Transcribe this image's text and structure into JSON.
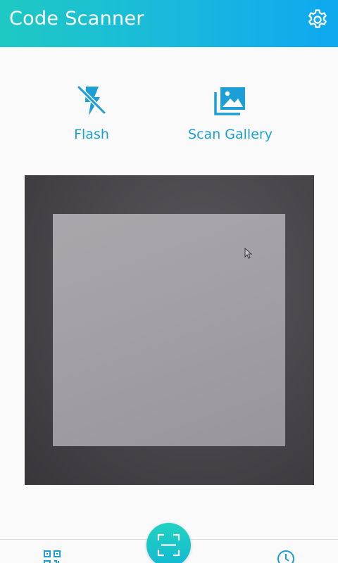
{
  "header": {
    "title": "Code Scanner",
    "icon": "gear-icon"
  },
  "actions": {
    "flash": {
      "label": "Flash",
      "icon": "flash-off-icon"
    },
    "gallery": {
      "label": "Scan Gallery",
      "icon": "gallery-icon"
    }
  },
  "bottom_nav": {
    "left_icon": "qr-code-icon",
    "center_icon": "scan-frame-icon",
    "right_icon": "history-clock-icon"
  },
  "colors": {
    "header_start": "#1fc9c3",
    "header_end": "#0ea8f0",
    "accent": "#1c9fd4",
    "background": "#fafafa"
  }
}
